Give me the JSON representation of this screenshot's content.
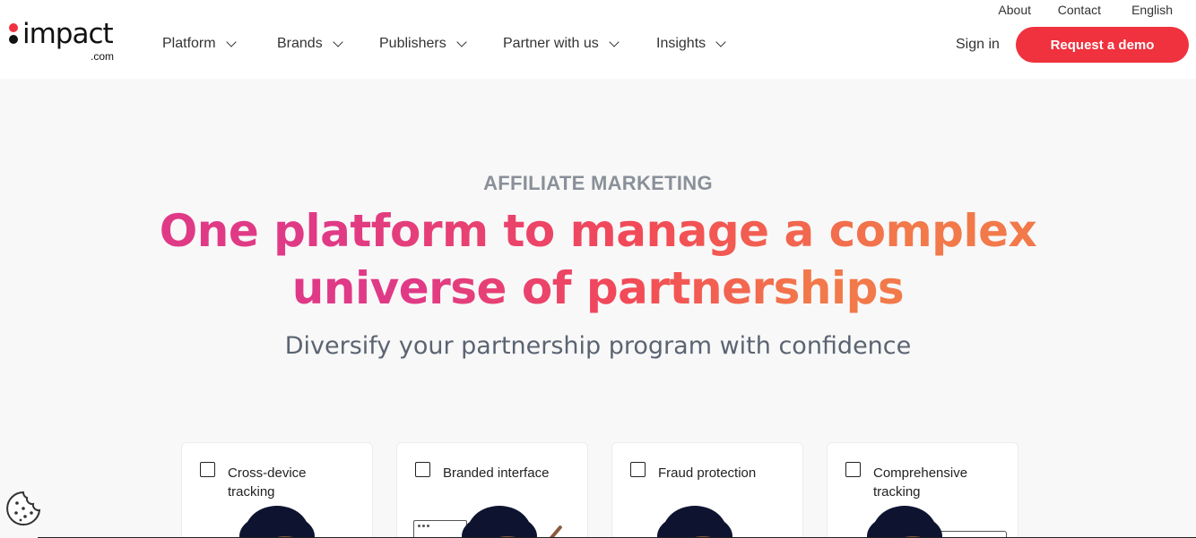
{
  "utility_nav": [
    "About",
    "Contact",
    "English"
  ],
  "logo": {
    "word": "impact",
    "domain": ".com"
  },
  "nav": [
    {
      "label": "Platform",
      "icon": "chevron-down-icon"
    },
    {
      "label": "Brands",
      "icon": "chevron-down-icon"
    },
    {
      "label": "Publishers",
      "icon": "chevron-down-icon"
    },
    {
      "label": "Partner with us",
      "icon": "chevron-down-icon"
    },
    {
      "label": "Insights",
      "icon": "chevron-down-icon"
    }
  ],
  "signin_label": "Sign in",
  "demo_label": "Request a demo",
  "hero": {
    "eyebrow": "AFFILIATE MARKETING",
    "headline_line1": "One platform to manage a complex",
    "headline_line2": "universe of partnerships",
    "subheadline": "Diversify your partnership program with confidence"
  },
  "features": [
    {
      "label": "Cross-device tracking",
      "checked": false
    },
    {
      "label": "Branded interface",
      "checked": false
    },
    {
      "label": "Fraud protection",
      "checked": false
    },
    {
      "label": "Comprehensive tracking",
      "checked": false
    }
  ],
  "colors": {
    "brand_red": "#f0313e",
    "gradient_pink": "#e03a86",
    "gradient_orange": "#f2794a",
    "eyebrow_gray": "#8a9099",
    "subhead_gray": "#5b6472"
  },
  "icons": {
    "cookie": "cookie-icon"
  }
}
